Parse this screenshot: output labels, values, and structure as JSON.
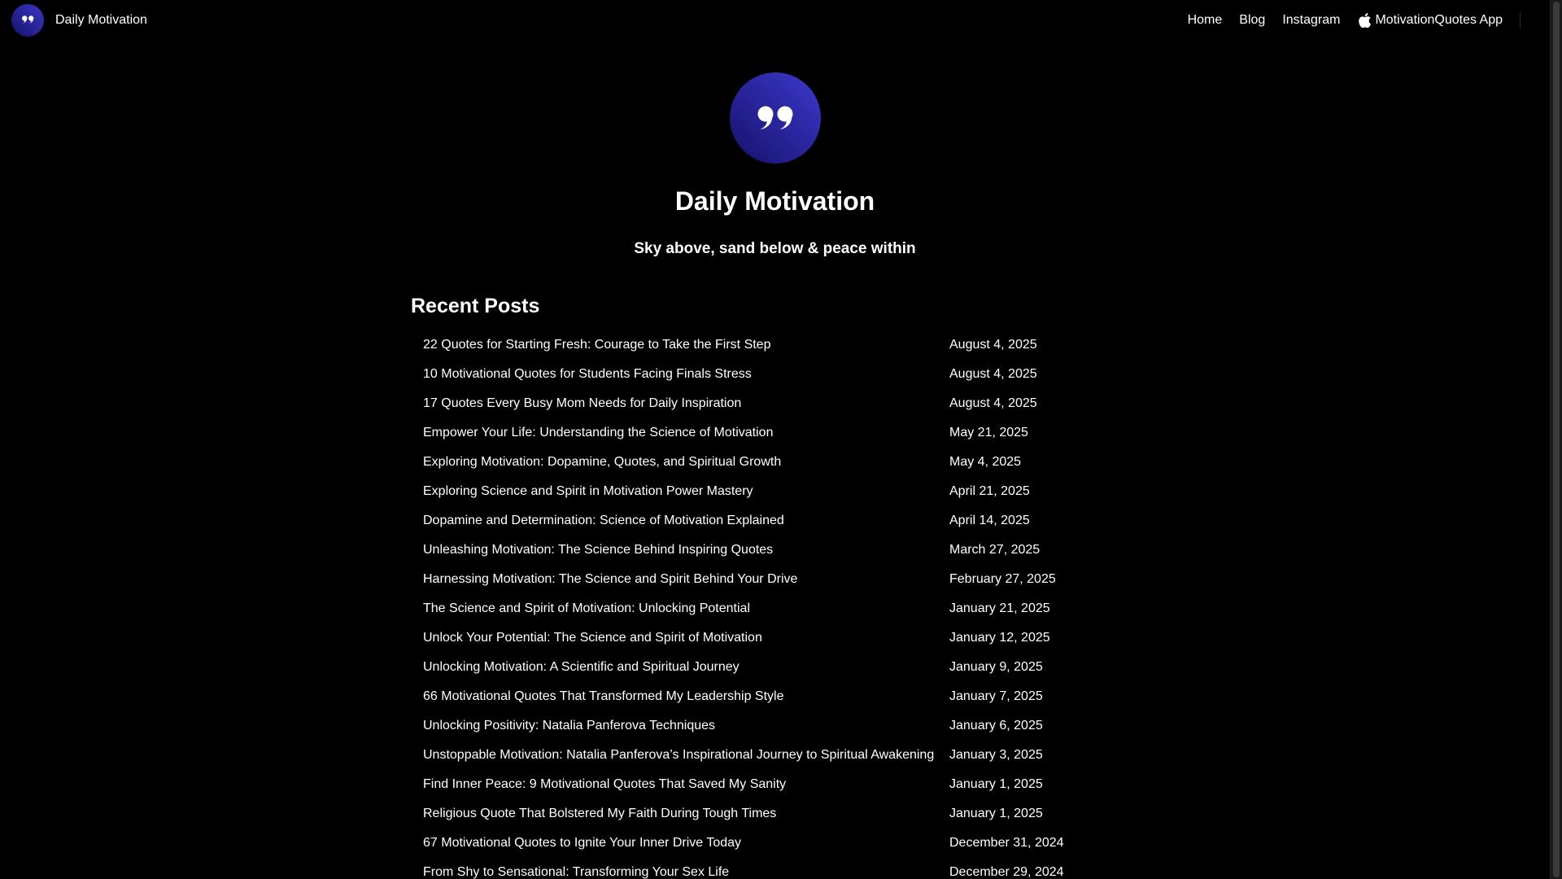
{
  "header": {
    "brand_name": "Daily Motivation",
    "nav": [
      {
        "label": "Home"
      },
      {
        "label": "Blog"
      },
      {
        "label": "Instagram"
      },
      {
        "label": "MotivationQuotes App",
        "icon": "apple-icon"
      }
    ]
  },
  "hero": {
    "logo_icon": "quote-icon",
    "title": "Daily Motivation",
    "tagline": "Sky above, sand below & peace within"
  },
  "recent_posts": {
    "heading": "Recent Posts",
    "items": [
      {
        "title": "22 Quotes for Starting Fresh: Courage to Take the First Step",
        "date": "August 4, 2025"
      },
      {
        "title": "10 Motivational Quotes for Students Facing Finals Stress",
        "date": "August 4, 2025"
      },
      {
        "title": "17 Quotes Every Busy Mom Needs for Daily Inspiration",
        "date": "August 4, 2025"
      },
      {
        "title": "Empower Your Life: Understanding the Science of Motivation",
        "date": "May 21, 2025"
      },
      {
        "title": "Exploring Motivation: Dopamine, Quotes, and Spiritual Growth",
        "date": "May 4, 2025"
      },
      {
        "title": "Exploring Science and Spirit in Motivation Power Mastery",
        "date": "April 21, 2025"
      },
      {
        "title": "Dopamine and Determination: Science of Motivation Explained",
        "date": "April 14, 2025"
      },
      {
        "title": "Unleashing Motivation: The Science Behind Inspiring Quotes",
        "date": "March 27, 2025"
      },
      {
        "title": "Harnessing Motivation: The Science and Spirit Behind Your Drive",
        "date": "February 27, 2025"
      },
      {
        "title": "The Science and Spirit of Motivation: Unlocking Potential",
        "date": "January 21, 2025"
      },
      {
        "title": "Unlock Your Potential: The Science and Spirit of Motivation",
        "date": "January 12, 2025"
      },
      {
        "title": "Unlocking Motivation: A Scientific and Spiritual Journey",
        "date": "January 9, 2025"
      },
      {
        "title": "66 Motivational Quotes That Transformed My Leadership Style",
        "date": "January 7, 2025"
      },
      {
        "title": "Unlocking Positivity: Natalia Panferova Techniques",
        "date": "January 6, 2025"
      },
      {
        "title": "Unstoppable Motivation: Natalia Panferova’s Inspirational Journey to Spiritual Awakening",
        "date": "January 3, 2025"
      },
      {
        "title": "Find Inner Peace: 9 Motivational Quotes That Saved My Sanity",
        "date": "January 1, 2025"
      },
      {
        "title": "Religious Quote That Bolstered My Faith During Tough Times",
        "date": "January 1, 2025"
      },
      {
        "title": "67 Motivational Quotes to Ignite Your Inner Drive Today",
        "date": "December 31, 2024"
      },
      {
        "title": "From Shy to Sensational: Transforming Your Sex Life",
        "date": "December 29, 2024"
      }
    ]
  },
  "colors": {
    "background": "#000000",
    "text": "#ffffff",
    "logo_gradient_start": "#1e1a6e",
    "logo_gradient_end": "#3a35c4"
  }
}
